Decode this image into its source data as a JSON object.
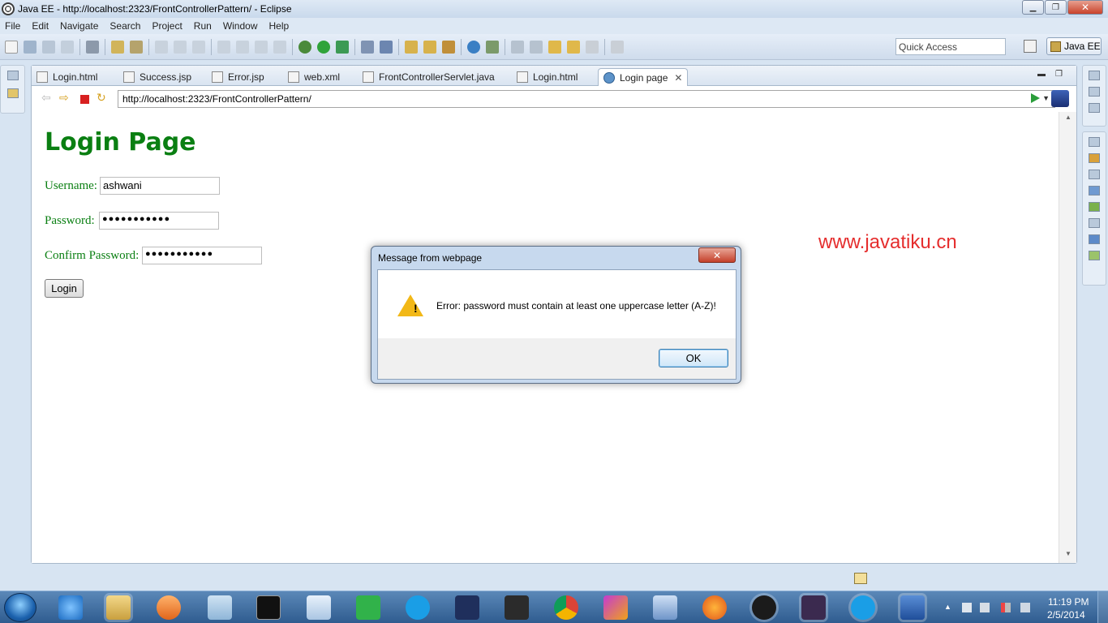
{
  "window": {
    "title": "Java EE - http://localhost:2323/FrontControllerPattern/ - Eclipse"
  },
  "menubar": {
    "items": [
      "File",
      "Edit",
      "Navigate",
      "Search",
      "Project",
      "Run",
      "Window",
      "Help"
    ]
  },
  "toolbar": {
    "quick_access": "Quick Access",
    "perspective": "Java EE"
  },
  "tabs": [
    {
      "label": "Login.html",
      "icon": "html-file-icon"
    },
    {
      "label": "Success.jsp",
      "icon": "jsp-file-icon"
    },
    {
      "label": "Error.jsp",
      "icon": "jsp-file-icon"
    },
    {
      "label": "web.xml",
      "icon": "xml-file-icon"
    },
    {
      "label": "FrontControllerServlet.java",
      "icon": "java-file-icon"
    },
    {
      "label": "Login.html",
      "icon": "html-file-icon"
    },
    {
      "label": "Login page",
      "icon": "globe-icon",
      "active": true
    }
  ],
  "browser": {
    "url": "http://localhost:2323/FrontControllerPattern/"
  },
  "page": {
    "title": "Login Page",
    "username_label": "Username:",
    "username_value": "ashwani",
    "password_label": "Password:",
    "password_value": "●●●●●●●●●●●",
    "confirm_label": "Confirm Password:",
    "confirm_value": "●●●●●●●●●●●",
    "login_button": "Login",
    "watermark": "www.javatiku.cn"
  },
  "dialog": {
    "title": "Message from webpage",
    "close": "✕",
    "message": "Error: password must contain at least one uppercase letter (A-Z)!",
    "ok": "OK"
  },
  "taskbar": {
    "time": "11:19 PM",
    "date": "2/5/2014",
    "apps": [
      "internet-explorer",
      "windows-explorer",
      "media-player",
      "notes",
      "command-prompt",
      "notepad",
      "qq",
      "skype",
      "cald3",
      "ms-to",
      "chrome",
      "pen-tool",
      "virtualbox",
      "firefox",
      "pdf-app",
      "java-ee-ide",
      "skype-active",
      "word"
    ]
  },
  "colors": {
    "accent_green": "#0a7f12",
    "watermark_red": "#e52d2d",
    "dialog_bg": "#c7d9ee"
  }
}
